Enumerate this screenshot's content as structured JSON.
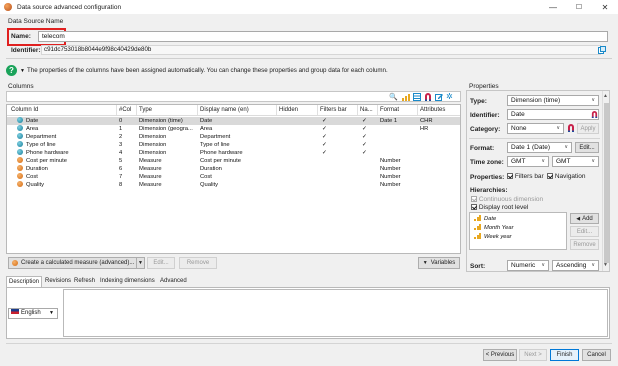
{
  "window": {
    "title": "Data source advanced configuration",
    "minimize": "—",
    "maximize": "☐",
    "close": "✕"
  },
  "datasource": {
    "section_label": "Data Source Name",
    "name_label": "Name:",
    "name_value": "telecom",
    "identifier_label": "Identifier:",
    "identifier_value": "c91dc753018b8044e9f98c40429de80b"
  },
  "info_text": "The properties of the columns have been assigned automatically. You can change these properties and group data for each column.",
  "columns": {
    "section_label": "Columns",
    "headers": [
      "Column Id",
      "#Col",
      "Type",
      "Display name (en)",
      "Hidden",
      "Filters bar",
      "Na...",
      "Format",
      "Attributes"
    ],
    "rows": [
      {
        "kind": "dim",
        "id": "Date",
        "col": "0",
        "type": "Dimension (time)",
        "display": "Date",
        "hidden": "",
        "filters": "✓",
        "nav": "✓",
        "format": "Date 1",
        "attributes": "CHR",
        "selected": true
      },
      {
        "kind": "dim",
        "id": "Area",
        "col": "1",
        "type": "Dimension (geogra...",
        "display": "Area",
        "hidden": "",
        "filters": "✓",
        "nav": "✓",
        "format": "",
        "attributes": "HR",
        "selected": false
      },
      {
        "kind": "dim",
        "id": "Department",
        "col": "2",
        "type": "Dimension",
        "display": "Department",
        "hidden": "",
        "filters": "✓",
        "nav": "✓",
        "format": "",
        "attributes": "",
        "selected": false
      },
      {
        "kind": "dim",
        "id": "Type of line",
        "col": "3",
        "type": "Dimension",
        "display": "Type of line",
        "hidden": "",
        "filters": "✓",
        "nav": "✓",
        "format": "",
        "attributes": "",
        "selected": false
      },
      {
        "kind": "dim",
        "id": "Phone hardware",
        "col": "4",
        "type": "Dimension",
        "display": "Phone hardware",
        "hidden": "",
        "filters": "✓",
        "nav": "✓",
        "format": "",
        "attributes": "",
        "selected": false
      },
      {
        "kind": "meas",
        "id": "Cost per minute",
        "col": "5",
        "type": "Measure",
        "display": "Cost per minute",
        "hidden": "",
        "filters": "",
        "nav": "",
        "format": "Number",
        "attributes": "",
        "selected": false
      },
      {
        "kind": "meas",
        "id": "Duration",
        "col": "6",
        "type": "Measure",
        "display": "Duration",
        "hidden": "",
        "filters": "",
        "nav": "",
        "format": "Number",
        "attributes": "",
        "selected": false
      },
      {
        "kind": "meas",
        "id": "Cost",
        "col": "7",
        "type": "Measure",
        "display": "Cost",
        "hidden": "",
        "filters": "",
        "nav": "",
        "format": "Number",
        "attributes": "",
        "selected": false
      },
      {
        "kind": "meas",
        "id": "Quality",
        "col": "8",
        "type": "Measure",
        "display": "Quality",
        "hidden": "",
        "filters": "",
        "nav": "",
        "format": "Number",
        "attributes": "",
        "selected": false
      }
    ],
    "create_measure_label": "Create a calculated measure (advanced)...",
    "edit_label": "Edit...",
    "remove_label": "Remove",
    "variables_label": "Variables"
  },
  "properties": {
    "section_label": "Properties",
    "type_label": "Type:",
    "type_value": "Dimension (time)",
    "identifier_label": "Identifier:",
    "identifier_value": "Date",
    "category_label": "Category:",
    "category_value": "None",
    "apply_label": "Apply",
    "format_label": "Format:",
    "format_value": "Date 1 (Date)",
    "format_edit": "Edit...",
    "timezone_label": "Time zone:",
    "timezone_value1": "GMT",
    "timezone_value2": "GMT",
    "props_label": "Properties:",
    "filters_bar_label": "Filters bar",
    "navigation_label": "Navigation",
    "hierarchies_label": "Hierarchies:",
    "continuous_label": "Continuous dimension",
    "display_root_label": "Display root level",
    "hierarchies": [
      "Date",
      "Month Year",
      "Week year"
    ],
    "add_label": "Add",
    "edit_label": "Edit...",
    "remove_label": "Remove",
    "sort_label": "Sort:",
    "sort_value1": "Numeric",
    "sort_value2": "Ascending"
  },
  "tabs": [
    "Description",
    "Revisions",
    "Refresh",
    "Indexing dimensions",
    "Advanced"
  ],
  "language": "English",
  "buttons": {
    "previous": "< Previous",
    "next": "Next >",
    "finish": "Finish",
    "cancel": "Cancel"
  },
  "colors": {
    "accent": "#0078d7",
    "highlight_box": "#e0201f",
    "help_icon": "#1aa35a",
    "selected_row": "#d9d9d9"
  }
}
